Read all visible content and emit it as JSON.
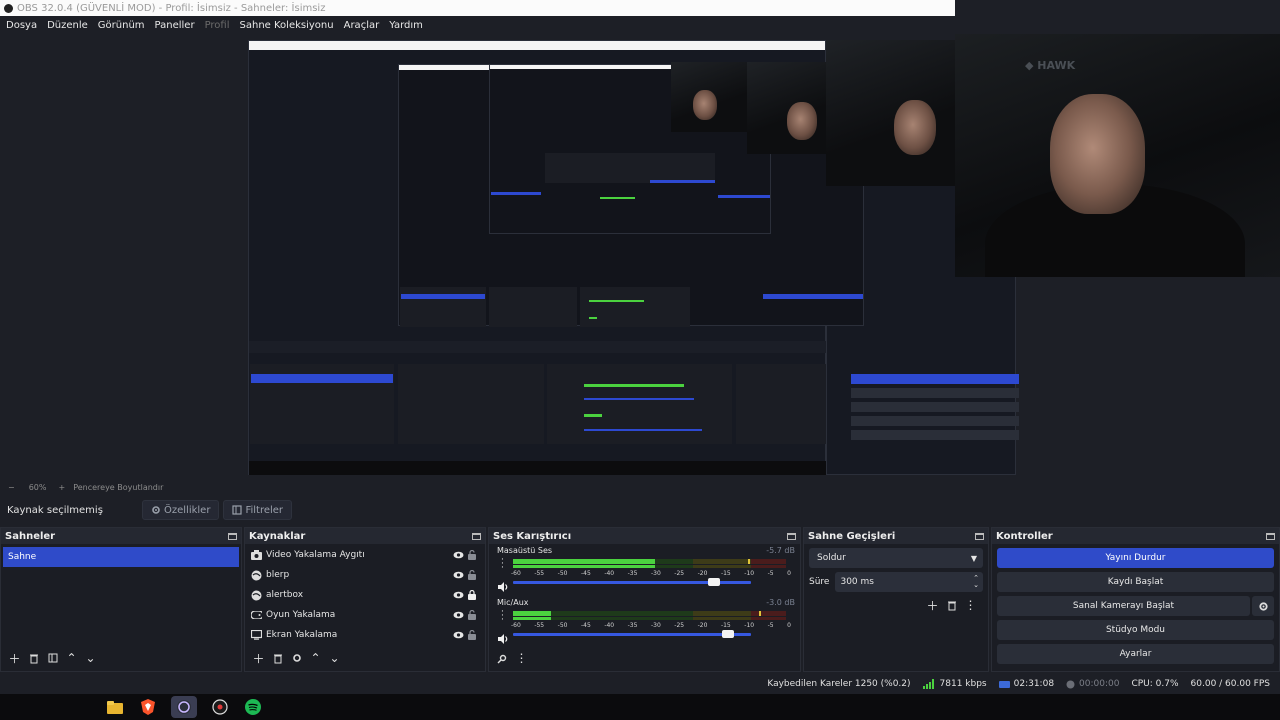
{
  "window": {
    "title": "OBS 32.0.4 (GÜVENLİ MOD) - Profil: İsimsiz - Sahneler: İsimsiz"
  },
  "menu": [
    {
      "label": "Dosya",
      "dim": false
    },
    {
      "label": "Düzenle",
      "dim": false
    },
    {
      "label": "Görünüm",
      "dim": false
    },
    {
      "label": "Paneller",
      "dim": false
    },
    {
      "label": "Profil",
      "dim": true
    },
    {
      "label": "Sahne Koleksiyonu",
      "dim": false
    },
    {
      "label": "Araçlar",
      "dim": false
    },
    {
      "label": "Yardım",
      "dim": false
    }
  ],
  "zoom": {
    "minus": "−",
    "value": "60%",
    "plus": "+",
    "fit_label": "Pencereye Boyutlandır"
  },
  "source_toolbar": {
    "no_source": "Kaynak seçilmemiş",
    "properties": "Özellikler",
    "filters": "Filtreler"
  },
  "scenes": {
    "title": "Sahneler",
    "items": [
      "Sahne"
    ]
  },
  "sources": {
    "title": "Kaynaklar",
    "items": [
      {
        "name": "Video Yakalama Aygıtı",
        "icon": "camera-icon",
        "locked": false
      },
      {
        "name": "blerp",
        "icon": "globe-icon",
        "locked": false
      },
      {
        "name": "alertbox",
        "icon": "globe-icon",
        "locked": true
      },
      {
        "name": "Oyun Yakalama",
        "icon": "gamepad-icon",
        "locked": false
      },
      {
        "name": "Ekran Yakalama",
        "icon": "monitor-icon",
        "locked": false
      }
    ]
  },
  "mixer": {
    "title": "Ses Karıştırıcı",
    "ticks": [
      "-60",
      "-55",
      "-50",
      "-45",
      "-40",
      "-35",
      "-30",
      "-25",
      "-20",
      "-15",
      "-10",
      "-5",
      "0"
    ],
    "channels": [
      {
        "name": "Masaüstü Ses",
        "db": "-5.7 dB",
        "level": 0.52,
        "peak": 0.86,
        "volume": 0.87
      },
      {
        "name": "Mic/Aux",
        "db": "-3.0 dB",
        "level": 0.14,
        "peak": 0.9,
        "volume": 0.93
      }
    ]
  },
  "transitions": {
    "title": "Sahne Geçişleri",
    "selected": "Soldur",
    "duration_label": "Süre",
    "duration_value": "300 ms"
  },
  "controls": {
    "title": "Kontroller",
    "stop_stream": "Yayını Durdur",
    "start_record": "Kaydı Başlat",
    "virtual_cam": "Sanal Kamerayı Başlat",
    "studio_mode": "Stüdyo Modu",
    "settings": "Ayarlar"
  },
  "status": {
    "dropped": "Kaybedilen Kareler 1250 (%0.2)",
    "bitrate": "7811 kbps",
    "stream_time": "02:31:08",
    "record_time": "00:00:00",
    "cpu": "CPU: 0.7%",
    "fps": "60.00 / 60.00 FPS"
  },
  "colors": {
    "accent": "#2f4bc9",
    "meter_green": "#4bd23f",
    "meter_yellow": "#c9c227",
    "meter_red": "#c8312b"
  }
}
